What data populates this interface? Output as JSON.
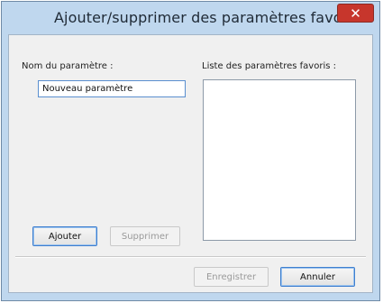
{
  "window": {
    "title": "Ajouter/supprimer des paramètres favoris",
    "close_symbol": "✕"
  },
  "form": {
    "name_label": "Nom du paramètre :",
    "name_value": "Nouveau paramètre",
    "list_label": "Liste des paramètres favoris :",
    "list_items": []
  },
  "buttons": {
    "add": "Ajouter",
    "delete": "Supprimer",
    "save": "Enregistrer",
    "cancel": "Annuler"
  },
  "colors": {
    "title_bar": "#bfd7ee",
    "close_button": "#c7362c",
    "dialog_background": "#f0f0f0"
  }
}
